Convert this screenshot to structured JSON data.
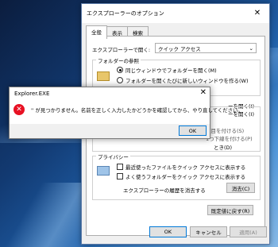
{
  "options_window": {
    "title": "エクスプローラーのオプション",
    "close_glyph": "✕",
    "tabs": [
      "全般",
      "表示",
      "検索"
    ],
    "open_explorer_label": "エクスプローラーで開く:",
    "open_explorer_value": "クイック アクセス",
    "folder_browse_label": "フォルダーの参照",
    "radio_same_window": "同じウィンドウでフォルダーを開く(M)",
    "radio_new_window": "フォルダーを開くたびに新しいウィンドウを作る(W)",
    "hidden_partial_1": "ーを開く(I)",
    "hidden_partial_2": "ーを開く(I)",
    "hidden_partial_3": "項目を付ける(S)",
    "hidden_partial_4": "1つ下線を付ける(P)",
    "hidden_partial_5": "とき(D)",
    "privacy_label": "プライバシー",
    "chk_recent_files": "最近使ったファイルをクイック アクセスに表示する",
    "chk_frequent_folders": "よく使うフォルダーをクイック アクセスに表示する",
    "clear_history_label": "エクスプローラーの履歴を消去する",
    "clear_button": "消去(C)",
    "restore_defaults_button": "既定値に戻す(R)",
    "ok_button": "OK",
    "cancel_button": "キャンセル",
    "apply_button": "適用(A)"
  },
  "error_dialog": {
    "title": "Explorer.EXE",
    "close_glyph": "✕",
    "icon_glyph": "✕",
    "message": "'' が見つかりません。名前を正しく入力したかどうかを確認してから、やり直してください。",
    "ok_button": "OK"
  },
  "colors": {
    "error_red": "#e81123",
    "focus_blue": "#0078d7"
  }
}
